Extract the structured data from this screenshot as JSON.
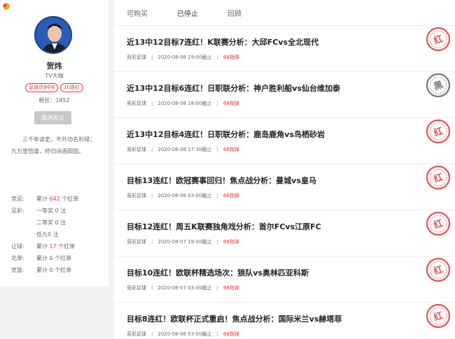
{
  "profile": {
    "name": "贺炜",
    "subtitle": "TV大咖",
    "badges": [
      "足球近9中8",
      "10连红"
    ],
    "fans_label": "粉丝：",
    "fans_count": "1852",
    "unfollow_label": "取消关注",
    "bio": "三千年读史，不外功名利禄；九万里悟道，终归诗酒田园。"
  },
  "stats": [
    {
      "label": "竞足:",
      "prefix": "累计",
      "value": "642",
      "suffix": "个红单"
    },
    {
      "label": "足彩:",
      "prefix": "一等奖",
      "value": "0",
      "suffix": "注"
    },
    {
      "label": "",
      "prefix": "二等奖",
      "value": "0",
      "suffix": "注"
    },
    {
      "label": "",
      "prefix": "任九",
      "value": "0",
      "suffix": "注"
    },
    {
      "label": "让球:",
      "prefix": "累计",
      "value": "17",
      "suffix": "个红单"
    },
    {
      "label": "北单:",
      "prefix": "累计",
      "value": "0",
      "suffix": "个红单"
    },
    {
      "label": "竞篮:",
      "prefix": "累计",
      "value": "0",
      "suffix": "个红单"
    }
  ],
  "tabs": [
    "可购买",
    "已停止",
    "回顾"
  ],
  "active_tab": "已停止",
  "items": [
    {
      "title": "近13中12目标7连红！K联赛分析：大邱FCvs全北现代",
      "category": "竞彩足球",
      "deadline": "2020-08-08 19:00截止",
      "price": "68指弹",
      "stamp": "红"
    },
    {
      "title": "近13中12目标6连红！日职联分析：神户胜利船vs仙台维加泰",
      "category": "竞彩足球",
      "deadline": "2020-08-08 18:00截止",
      "price": "68指弹",
      "stamp": "黑"
    },
    {
      "title": "近13中12目标4连红！日职联分析：鹿岛鹿角vs鸟栖砂岩",
      "category": "竞彩足球",
      "deadline": "2020-08-08 17:30截止",
      "price": "68指弹",
      "stamp": "红"
    },
    {
      "title": "目标13连红！欧冠赛事回归！焦点战分析：曼城vs皇马",
      "category": "竞彩足球",
      "deadline": "2020-08-08 03:00截止",
      "price": "68指弹",
      "stamp": "红"
    },
    {
      "title": "目标12连红！周五K联赛独角戏分析：首尔FCvs江原FC",
      "category": "竞彩足球",
      "deadline": "2020-08-07 19:00截止",
      "price": "68指弹",
      "stamp": "红"
    },
    {
      "title": "目标10连红！欧联杯精选场次：狼队vs奥林匹亚科斯",
      "category": "竞彩足球",
      "deadline": "2020-08-07 03:00截止",
      "price": "68指弹",
      "stamp": "红"
    },
    {
      "title": "目标8连红！欧联杯正式重启！焦点战分析：国际米兰vs赫塔菲",
      "category": "竞彩足球",
      "deadline": "2020-08-06 03:00截止",
      "price": "68指弹",
      "stamp": "红"
    }
  ],
  "colors": {
    "accent_red": "#e33333",
    "stamp_red": "#e05555",
    "stamp_black": "#777777"
  }
}
